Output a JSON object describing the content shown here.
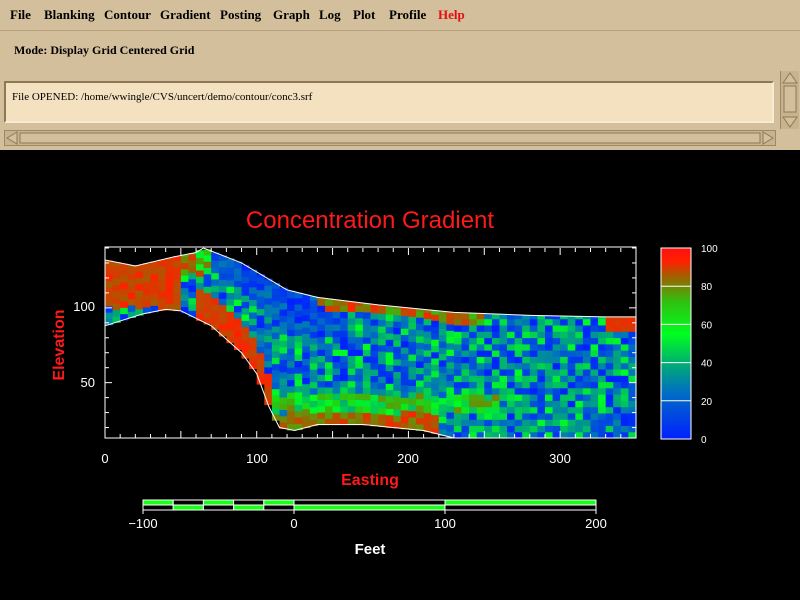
{
  "menubar": {
    "items": [
      {
        "label": "File"
      },
      {
        "label": "Blanking"
      },
      {
        "label": "Contour"
      },
      {
        "label": "Gradient"
      },
      {
        "label": "Posting"
      },
      {
        "label": "Graph"
      },
      {
        "label": "Log"
      },
      {
        "label": "Plot"
      },
      {
        "label": "Profile"
      },
      {
        "label": "Help"
      }
    ]
  },
  "mode": {
    "text": "Mode: Display Grid Centered Grid"
  },
  "log": {
    "text": "File OPENED: /home/wwingle/CVS/uncert/demo/contour/conc3.srf"
  },
  "colors": {
    "menu_bg": "#d4bf9c",
    "help": "#e01010",
    "title": "#ff1a1a",
    "axis_title": "#ff1a1a",
    "plot_bg": "#000000",
    "scale_fill": "#1aff1a"
  },
  "chart_data": {
    "type": "heatmap",
    "title": "Concentration Gradient",
    "xlabel": "Easting",
    "ylabel": "Elevation",
    "xlim": [
      0,
      350
    ],
    "ylim": [
      13,
      140
    ],
    "xticks": [
      "0",
      "100",
      "200",
      "300"
    ],
    "yticks": [
      "50",
      "100"
    ],
    "colorbar": {
      "ticks": [
        "100",
        "80",
        "60",
        "40",
        "20",
        "0"
      ],
      "range": [
        0,
        100
      ],
      "stops": [
        "#0020ff",
        "#008aa0",
        "#00ff20",
        "#8a8a00",
        "#ff2000"
      ]
    },
    "top_boundary": [
      [
        0,
        132
      ],
      [
        20,
        128
      ],
      [
        45,
        134
      ],
      [
        60,
        137
      ],
      [
        65,
        140
      ],
      [
        90,
        130
      ],
      [
        120,
        112
      ],
      [
        140,
        107
      ],
      [
        180,
        102
      ],
      [
        230,
        97
      ],
      [
        280,
        95
      ],
      [
        330,
        94
      ],
      [
        350,
        94
      ]
    ],
    "bottom_boundary": [
      [
        0,
        88
      ],
      [
        25,
        96
      ],
      [
        40,
        99
      ],
      [
        50,
        98
      ],
      [
        70,
        88
      ],
      [
        90,
        70
      ],
      [
        100,
        56
      ],
      [
        108,
        34
      ],
      [
        115,
        20
      ],
      [
        125,
        18
      ],
      [
        140,
        22
      ],
      [
        170,
        22
      ],
      [
        210,
        18
      ],
      [
        230,
        13
      ],
      [
        350,
        13
      ]
    ],
    "description_bands": [
      {
        "region": "upper-left wedge",
        "value": 100
      },
      {
        "region": "lower-middle band",
        "value": 100
      },
      {
        "region": "interior",
        "value": 10
      }
    ]
  },
  "scale_bar": {
    "ticks": [
      "−100",
      "0",
      "100",
      "200"
    ],
    "label": "Feet",
    "range": [
      -100,
      200
    ]
  }
}
